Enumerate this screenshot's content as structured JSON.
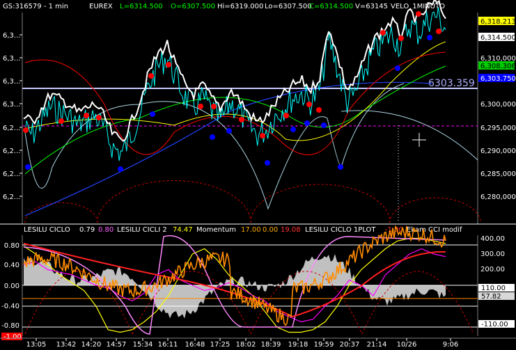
{
  "header": {
    "symbol": "GS:316579 - 1 min",
    "exchange": "EUREX",
    "low": "L=6314.500",
    "open": "O=6307.500",
    "high": "Hi=6319.000",
    "low2": "Lo=6307.500",
    "close": "C=6314.500",
    "volume": "V=63145",
    "study": "VELO_1MINUTO"
  },
  "price_labels": {
    "top": "6,318.213",
    "close": "6,314.500",
    "green": "6,308.306",
    "blue": "6,303.750",
    "level": "6303.359"
  },
  "indicator_header": {
    "l1": "LESILU CICLO",
    "v1": "0.79",
    "v2": "0.80",
    "l2": "LESILU CICLI 2",
    "v3": "74.47",
    "l3": "Momentum",
    "v4": "17.00",
    "v5": "0.00",
    "v6": "19.08",
    "l4": "LESILU CICLO 1PLOT",
    "v7": "-1.00",
    "l5": "Ekam CCI modif"
  },
  "indicator_labels": {
    "cci1": "110.00",
    "cci2": "57.82",
    "cci3": "-110.00",
    "min": "-1.00"
  },
  "colors": {
    "price": "#ffffff",
    "cyan": "#00ffff",
    "red": "#ff0000",
    "blue": "#0000ff",
    "green": "#00ff00",
    "yellow": "#ffff00",
    "orange": "#ff8c00",
    "magenta": "#ff00ff",
    "gray": "#c0c0c0",
    "lightblue": "#add8e6"
  },
  "chart_data": [
    {
      "type": "line",
      "y_ticks": [
        "6,3...",
        "6,3...",
        "6,3...",
        "6,3...",
        "6,2...",
        "6,2...",
        "6,2...",
        "6,2..."
      ],
      "y_right_ticks": [
        "6,310,000",
        "6,300,000",
        "6,295,000",
        "6,290,000",
        "6,285,000",
        "6,280,000"
      ],
      "x_ticks": [
        "13:05",
        "13:42",
        "14:20",
        "14:57",
        "15:34",
        "16:11",
        "16:48",
        "17:25",
        "18:02",
        "18:39",
        "19:18",
        "19:59",
        "20:37",
        "21:14",
        "10/26",
        "9:06"
      ],
      "price_series": [
        [
          0,
          6292
        ],
        [
          1,
          6291
        ],
        [
          2,
          6294
        ],
        [
          3,
          6297
        ],
        [
          4,
          6296
        ],
        [
          5,
          6295
        ],
        [
          6,
          6293
        ],
        [
          7,
          6294
        ],
        [
          8,
          6295
        ],
        [
          9,
          6292
        ],
        [
          10,
          6288
        ],
        [
          11,
          6287
        ],
        [
          12,
          6291
        ],
        [
          13,
          6296
        ],
        [
          14,
          6302
        ],
        [
          15,
          6306
        ],
        [
          16,
          6308
        ],
        [
          17,
          6303
        ],
        [
          18,
          6299
        ],
        [
          19,
          6297
        ],
        [
          20,
          6299
        ],
        [
          21,
          6296
        ],
        [
          22,
          6294
        ],
        [
          23,
          6298
        ],
        [
          24,
          6296
        ],
        [
          25,
          6293
        ],
        [
          26,
          6291
        ],
        [
          27,
          6292
        ],
        [
          28,
          6295
        ],
        [
          29,
          6297
        ],
        [
          30,
          6299
        ],
        [
          31,
          6300
        ],
        [
          32,
          6298
        ],
        [
          33,
          6301
        ],
        [
          34,
          6312
        ],
        [
          35,
          6305
        ],
        [
          36,
          6298
        ],
        [
          37,
          6300
        ],
        [
          38,
          6305
        ],
        [
          39,
          6309
        ],
        [
          40,
          6311
        ],
        [
          41,
          6313
        ],
        [
          42,
          6310
        ],
        [
          43,
          6315
        ],
        [
          44,
          6313
        ],
        [
          45,
          6316
        ],
        [
          46,
          6317
        ],
        [
          47,
          6314
        ]
      ]
    },
    {
      "type": "line",
      "y_ticks": [
        "0.80",
        "0.40",
        "0.00",
        "-0.40",
        "-0.80"
      ],
      "y_right_ticks": [
        "400.00",
        "300.00",
        "200.00",
        "110.00",
        "-110.00"
      ],
      "series": [
        {
          "name": "LESILU CICLO",
          "values": [
            0.75,
            0.6,
            0.4,
            0.2,
            0.05,
            -0.1,
            -0.4,
            -0.85,
            -0.9,
            -0.85,
            -0.7,
            -0.5,
            -0.2,
            0.2,
            0.6,
            0.7,
            0.5,
            0.2,
            0.0,
            -0.2,
            -0.5,
            -0.8,
            -0.9,
            -0.9,
            -0.85,
            -0.7,
            -0.4,
            0.0,
            0.3,
            0.5,
            0.7,
            0.85,
            0.9,
            0.9,
            0.85,
            0.8
          ]
        },
        {
          "name": "Momentum",
          "values": [
            0.4,
            0.45,
            0.3,
            0.25,
            0.2,
            0.1,
            0.0,
            -0.05,
            -0.2,
            -0.3,
            -0.15,
            0.2,
            0.3,
            0.1,
            0.0,
            -0.1,
            -0.05,
            0.05,
            -0.05,
            -0.2,
            -0.3,
            -0.5,
            -0.6,
            -0.7,
            -0.65,
            -0.4,
            -0.2,
            0.1,
            0.0,
            -0.2,
            0.2,
            0.4,
            0.6,
            0.7,
            0.6,
            0.55
          ]
        }
      ]
    }
  ]
}
